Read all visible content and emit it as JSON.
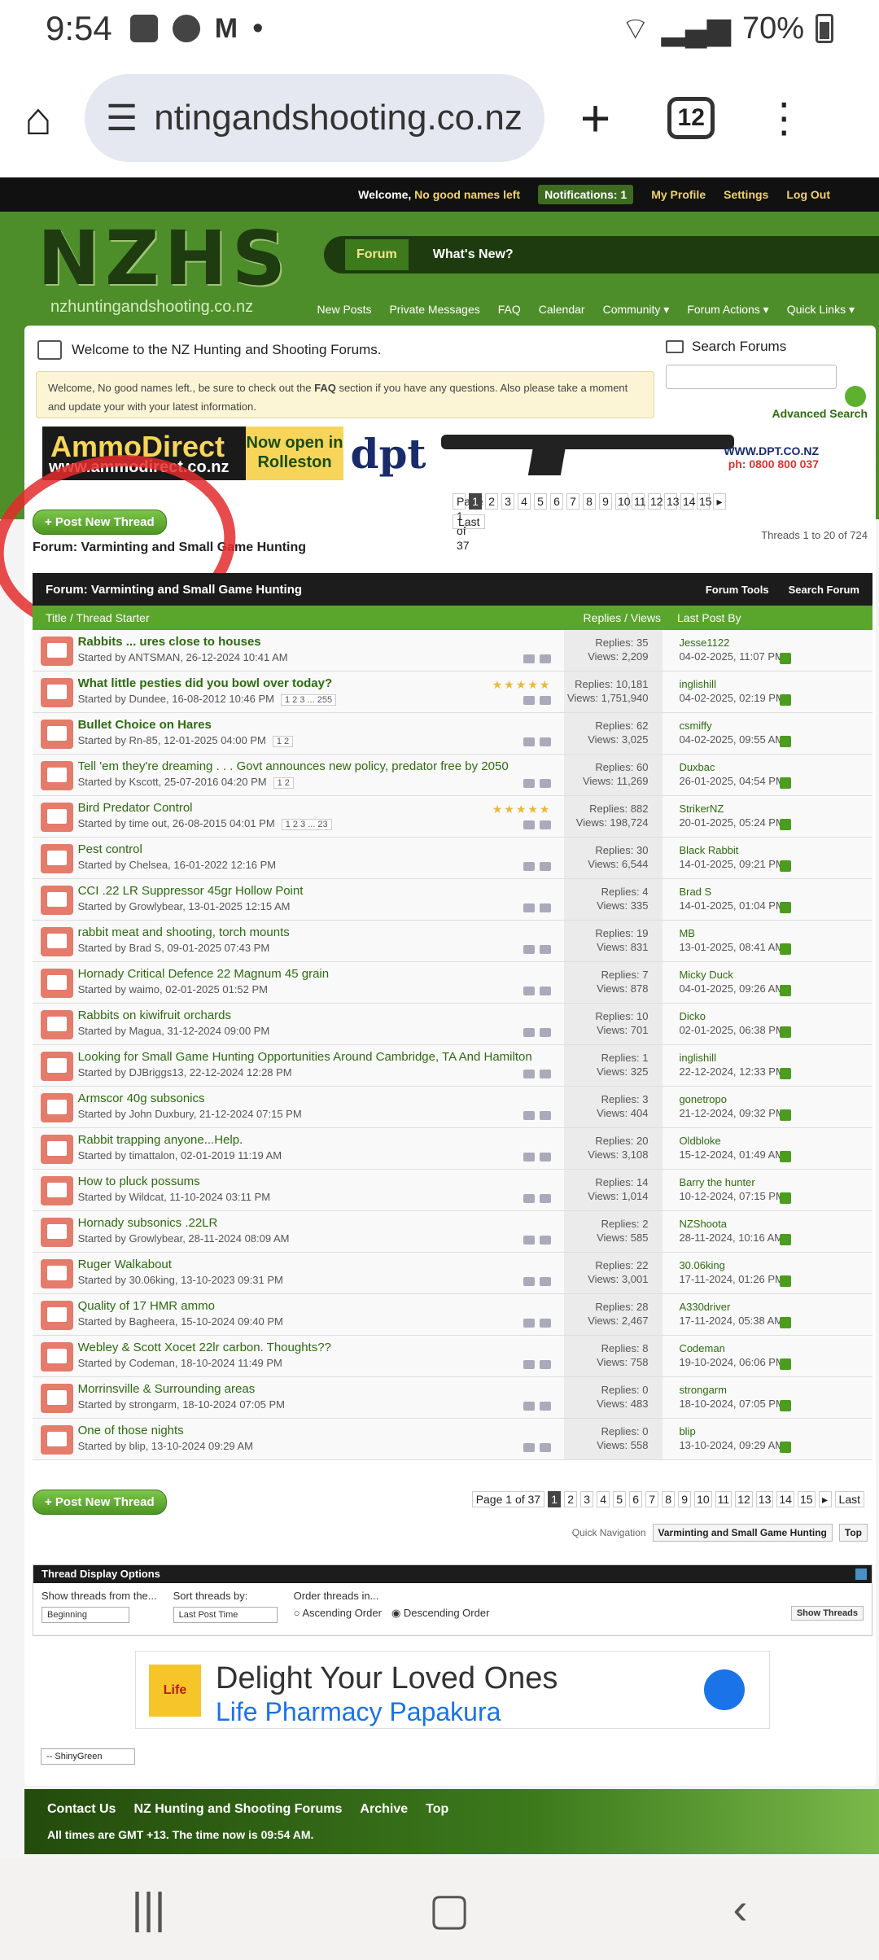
{
  "status": {
    "time": "9:54",
    "battery": "70%"
  },
  "browser": {
    "url": "ntingandshooting.co.nz",
    "tabs": "12"
  },
  "top": {
    "welcome": "Welcome,",
    "user": "No good names left",
    "notifications": "Notifications: 1",
    "profile": "My Profile",
    "settings": "Settings",
    "logout": "Log Out"
  },
  "logo": {
    "big": "NZHS",
    "small": "nzhuntingandshooting.co.nz"
  },
  "nav": {
    "forum": "Forum",
    "whatsnew": "What's New?"
  },
  "subnav": [
    "New Posts",
    "Private Messages",
    "FAQ",
    "Calendar",
    "Community ▾",
    "Forum Actions ▾",
    "Quick Links ▾"
  ],
  "welcome": {
    "title": "Welcome to the NZ Hunting and Shooting Forums.",
    "notice_pre": "Welcome, No good names left., be sure to check out the ",
    "notice_faq": "FAQ",
    "notice_post": " section if you have any questions. Also please take a moment and update your with your latest information."
  },
  "search": {
    "label": "Search Forums",
    "advanced": "Advanced Search"
  },
  "banner": {
    "ammo": "AmmoDirect",
    "ammo_url": "www.ammodirect.co.nz",
    "open": "Now open in Rolleston",
    "dpt": "dpt",
    "dpt_url": "WWW.DPT.CO.NZ",
    "dpt_ph": "ph: 0800 800 037"
  },
  "forum": {
    "post_new": "+ Post New Thread",
    "title": "Forum: Varminting and Small Game Hunting",
    "page_of": "Page 1 of 37",
    "last": "Last",
    "threads_count": "Threads 1 to 20 of 724",
    "tools": "Forum Tools",
    "search": "Search Forum",
    "col_title": "Title / Thread Starter",
    "col_rv": "Replies / Views",
    "col_last": "Last Post By"
  },
  "pages": [
    "1",
    "2",
    "3",
    "4",
    "5",
    "6",
    "7",
    "8",
    "9",
    "10",
    "11",
    "12",
    "13",
    "14",
    "15"
  ],
  "threads": [
    {
      "title": "Rabbits ... ures close to houses",
      "by": "Started by ANTSMAN, 26-12-2024 10:41 AM",
      "replies": "Replies: 35",
      "views": "Views: 2,209",
      "last_user": "Jesse1122",
      "last_date": "04-02-2025, 11:07 PM",
      "bold": true
    },
    {
      "title": "What little pesties did you bowl over today?",
      "by": "Started by Dundee, 16-08-2012 10:46 PM",
      "pages": "1 2 3 ... 255",
      "replies": "Replies: 10,181",
      "views": "Views: 1,751,940",
      "last_user": "inglishill",
      "last_date": "04-02-2025, 02:19 PM",
      "bold": true,
      "stars": true
    },
    {
      "title": "Bullet Choice on Hares",
      "by": "Started by Rn-85, 12-01-2025 04:00 PM",
      "pages": "1 2",
      "replies": "Replies: 62",
      "views": "Views: 3,025",
      "last_user": "csmiffy",
      "last_date": "04-02-2025, 09:55 AM",
      "bold": true
    },
    {
      "title": "Tell 'em they're dreaming . . . Govt announces new policy, predator free by 2050",
      "by": "Started by Kscott, 25-07-2016 04:20 PM",
      "pages": "1 2",
      "replies": "Replies: 60",
      "views": "Views: 11,269",
      "last_user": "Duxbac",
      "last_date": "26-01-2025, 04:54 PM"
    },
    {
      "title": "Bird Predator Control",
      "by": "Started by time out, 26-08-2015 04:01 PM",
      "pages": "1 2 3 ... 23",
      "replies": "Replies: 882",
      "views": "Views: 198,724",
      "last_user": "StrikerNZ",
      "last_date": "20-01-2025, 05:24 PM",
      "stars": true
    },
    {
      "title": "Pest control",
      "by": "Started by Chelsea, 16-01-2022 12:16 PM",
      "replies": "Replies: 30",
      "views": "Views: 6,544",
      "last_user": "Black Rabbit",
      "last_date": "14-01-2025, 09:21 PM"
    },
    {
      "title": "CCI .22 LR Suppressor 45gr Hollow Point",
      "by": "Started by Growlybear, 13-01-2025 12:15 AM",
      "replies": "Replies: 4",
      "views": "Views: 335",
      "last_user": "Brad S",
      "last_date": "14-01-2025, 01:04 PM"
    },
    {
      "title": "rabbit meat and shooting, torch mounts",
      "by": "Started by Brad S, 09-01-2025 07:43 PM",
      "replies": "Replies: 19",
      "views": "Views: 831",
      "last_user": "MB",
      "last_date": "13-01-2025, 08:41 AM"
    },
    {
      "title": "Hornady Critical Defence 22 Magnum 45 grain",
      "by": "Started by waimo, 02-01-2025 01:52 PM",
      "replies": "Replies: 7",
      "views": "Views: 878",
      "last_user": "Micky Duck",
      "last_date": "04-01-2025, 09:26 AM"
    },
    {
      "title": "Rabbits on kiwifruit orchards",
      "by": "Started by Magua, 31-12-2024 09:00 PM",
      "replies": "Replies: 10",
      "views": "Views: 701",
      "last_user": "Dicko",
      "last_date": "02-01-2025, 06:38 PM"
    },
    {
      "title": "Looking for Small Game Hunting Opportunities Around Cambridge, TA And Hamilton",
      "by": "Started by DJBriggs13, 22-12-2024 12:28 PM",
      "replies": "Replies: 1",
      "views": "Views: 325",
      "last_user": "inglishill",
      "last_date": "22-12-2024, 12:33 PM"
    },
    {
      "title": "Armscor 40g subsonics",
      "by": "Started by John Duxbury, 21-12-2024 07:15 PM",
      "replies": "Replies: 3",
      "views": "Views: 404",
      "last_user": "gonetropo",
      "last_date": "21-12-2024, 09:32 PM"
    },
    {
      "title": "Rabbit trapping anyone...Help.",
      "by": "Started by timattalon, 02-01-2019 11:19 AM",
      "replies": "Replies: 20",
      "views": "Views: 3,108",
      "last_user": "Oldbloke",
      "last_date": "15-12-2024, 01:49 AM"
    },
    {
      "title": "How to pluck possums",
      "by": "Started by Wildcat, 11-10-2024 03:11 PM",
      "replies": "Replies: 14",
      "views": "Views: 1,014",
      "last_user": "Barry the hunter",
      "last_date": "10-12-2024, 07:15 PM"
    },
    {
      "title": "Hornady subsonics .22LR",
      "by": "Started by Growlybear, 28-11-2024 08:09 AM",
      "replies": "Replies: 2",
      "views": "Views: 585",
      "last_user": "NZShoota",
      "last_date": "28-11-2024, 10:16 AM"
    },
    {
      "title": "Ruger Walkabout",
      "by": "Started by 30.06king, 13-10-2023 09:31 PM",
      "replies": "Replies: 22",
      "views": "Views: 3,001",
      "last_user": "30.06king",
      "last_date": "17-11-2024, 01:26 PM"
    },
    {
      "title": "Quality of 17 HMR ammo",
      "by": "Started by Bagheera, 15-10-2024 09:40 PM",
      "replies": "Replies: 28",
      "views": "Views: 2,467",
      "last_user": "A330driver",
      "last_date": "17-11-2024, 05:38 AM"
    },
    {
      "title": "Webley & Scott Xocet 22lr carbon. Thoughts??",
      "by": "Started by Codeman, 18-10-2024 11:49 PM",
      "replies": "Replies: 8",
      "views": "Views: 758",
      "last_user": "Codeman",
      "last_date": "19-10-2024, 06:06 PM"
    },
    {
      "title": "Morrinsville & Surrounding areas",
      "by": "Started by strongarm, 18-10-2024 07:05 PM",
      "replies": "Replies: 0",
      "views": "Views: 483",
      "last_user": "strongarm",
      "last_date": "18-10-2024, 07:05 PM"
    },
    {
      "title": "One of those nights",
      "by": "Started by blip, 13-10-2024 09:29 AM",
      "replies": "Replies: 0",
      "views": "Views: 558",
      "last_user": "blip",
      "last_date": "13-10-2024, 09:29 AM"
    }
  ],
  "quicknav": {
    "label": "Quick Navigation",
    "value": "Varminting and Small Game Hunting",
    "top": "Top"
  },
  "tdo": {
    "title": "Thread Display Options",
    "show_from": "Show threads from the...",
    "show_from_val": "Beginning",
    "sort_by": "Sort threads by:",
    "sort_val": "Last Post Time",
    "order": "Order threads in...",
    "asc": "Ascending Order",
    "desc": "Descending Order",
    "show_btn": "Show Threads"
  },
  "ad": {
    "logo": "Life",
    "line1": "Delight Your Loved Ones",
    "line2": "Life Pharmacy Papakura"
  },
  "style": {
    "value": "-- ShinyGreen"
  },
  "footer": {
    "links": [
      "Contact Us",
      "NZ Hunting and Shooting Forums",
      "Archive",
      "Top"
    ],
    "tz": "All times are GMT +13. The time now is 09:54 AM."
  }
}
